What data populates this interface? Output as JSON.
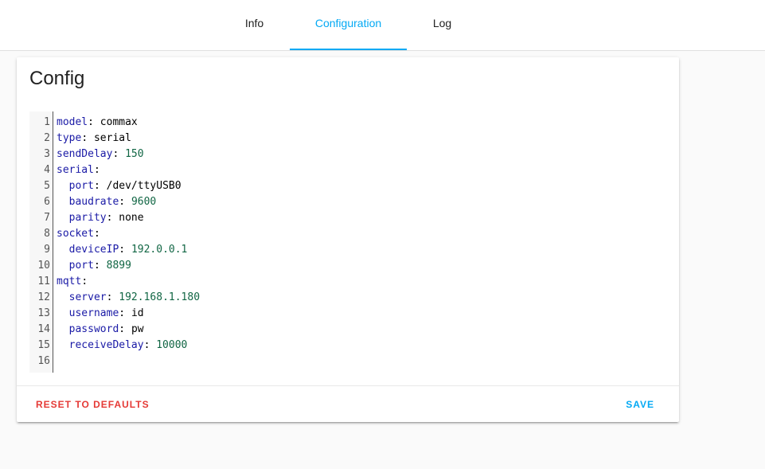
{
  "tabs": [
    {
      "label": "Info",
      "active": false
    },
    {
      "label": "Configuration",
      "active": true
    },
    {
      "label": "Log",
      "active": false
    }
  ],
  "card": {
    "title": "Config",
    "reset_label": "RESET TO DEFAULTS",
    "save_label": "SAVE"
  },
  "editor": {
    "lines": [
      {
        "num": "1",
        "indent": "",
        "key": "model",
        "sep": ": ",
        "value": "commax",
        "vtype": "str"
      },
      {
        "num": "2",
        "indent": "",
        "key": "type",
        "sep": ": ",
        "value": "serial",
        "vtype": "str"
      },
      {
        "num": "3",
        "indent": "",
        "key": "sendDelay",
        "sep": ": ",
        "value": "150",
        "vtype": "num"
      },
      {
        "num": "4",
        "indent": "",
        "key": "serial",
        "sep": ":",
        "value": "",
        "vtype": "str"
      },
      {
        "num": "5",
        "indent": "  ",
        "key": "port",
        "sep": ": ",
        "value": "/dev/ttyUSB0",
        "vtype": "str"
      },
      {
        "num": "6",
        "indent": "  ",
        "key": "baudrate",
        "sep": ": ",
        "value": "9600",
        "vtype": "num"
      },
      {
        "num": "7",
        "indent": "  ",
        "key": "parity",
        "sep": ": ",
        "value": "none",
        "vtype": "str"
      },
      {
        "num": "8",
        "indent": "",
        "key": "socket",
        "sep": ":",
        "value": "",
        "vtype": "str"
      },
      {
        "num": "9",
        "indent": "  ",
        "key": "deviceIP",
        "sep": ": ",
        "value": "192.0.0.1",
        "vtype": "num"
      },
      {
        "num": "10",
        "indent": "  ",
        "key": "port",
        "sep": ": ",
        "value": "8899",
        "vtype": "num"
      },
      {
        "num": "11",
        "indent": "",
        "key": "mqtt",
        "sep": ":",
        "value": "",
        "vtype": "str"
      },
      {
        "num": "12",
        "indent": "  ",
        "key": "server",
        "sep": ": ",
        "value": "192.168.1.180",
        "vtype": "num"
      },
      {
        "num": "13",
        "indent": "  ",
        "key": "username",
        "sep": ": ",
        "value": "id",
        "vtype": "str"
      },
      {
        "num": "14",
        "indent": "  ",
        "key": "password",
        "sep": ": ",
        "value": "pw",
        "vtype": "str"
      },
      {
        "num": "15",
        "indent": "  ",
        "key": "receiveDelay",
        "sep": ": ",
        "value": "10000",
        "vtype": "num"
      },
      {
        "num": "16",
        "indent": "",
        "key": "",
        "sep": "",
        "value": "",
        "vtype": "str"
      }
    ]
  },
  "colors": {
    "accent": "#03a9f4",
    "danger": "#e53935",
    "key": "#1a1aa6",
    "number": "#116644"
  }
}
